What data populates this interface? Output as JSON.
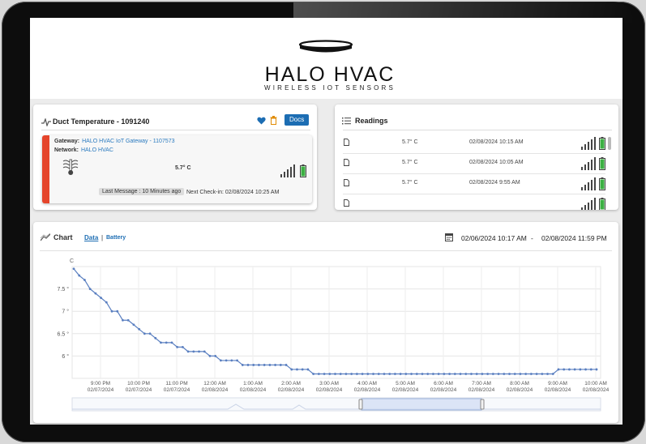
{
  "header": {
    "brand": "HALO HVAC",
    "tagline": "WIRELESS IOT SENSORS"
  },
  "sensor": {
    "title": "Duct Temperature - 1091240",
    "docs_label": "Docs",
    "gateway_label": "Gateway:",
    "gateway_value": "HALO HVAC IoT Gateway - 1107573",
    "network_label": "Network:",
    "network_value": "HALO HVAC",
    "temperature": "5.7° C",
    "last_message": "Last Message : 10 Minutes ago",
    "next_checkin": "Next Check-in: 02/08/2024   10:25 AM",
    "accent_color": "#e5452b"
  },
  "readings": {
    "title": "Readings",
    "rows": [
      {
        "value": "5.7° C",
        "time": "02/08/2024 10:15 AM"
      },
      {
        "value": "5.7° C",
        "time": "02/08/2024 10:05 AM"
      },
      {
        "value": "5.7° C",
        "time": "02/08/2024 9:55 AM"
      }
    ]
  },
  "chart": {
    "title": "Chart",
    "tab_data": "Data",
    "tab_separator": "|",
    "tab_battery": "Battery",
    "date_start": "02/06/2024 10:17 AM",
    "date_separator": "-",
    "date_end": "02/08/2024 11:59 PM"
  },
  "colors": {
    "brand_blue": "#1c6db3",
    "line": "#5a7fc0",
    "battery_green": "#3cb043"
  },
  "chart_data": {
    "type": "line",
    "ylabel": "C",
    "ylim": [
      5.5,
      8.0
    ],
    "yticks": [
      {
        "label": "7.5 °",
        "v": 7.5
      },
      {
        "label": "7 °",
        "v": 7.0
      },
      {
        "label": "6.5 °",
        "v": 6.5
      },
      {
        "label": "6 °",
        "v": 6.0
      }
    ],
    "xticks": [
      {
        "t": "9:00 PM",
        "d": "02/07/2024"
      },
      {
        "t": "10:00 PM",
        "d": "02/07/2024"
      },
      {
        "t": "11:00 PM",
        "d": "02/07/2024"
      },
      {
        "t": "12:00 AM",
        "d": "02/08/2024"
      },
      {
        "t": "1:00 AM",
        "d": "02/08/2024"
      },
      {
        "t": "2:00 AM",
        "d": "02/08/2024"
      },
      {
        "t": "3:00 AM",
        "d": "02/08/2024"
      },
      {
        "t": "4:00 AM",
        "d": "02/08/2024"
      },
      {
        "t": "5:00 AM",
        "d": "02/08/2024"
      },
      {
        "t": "6:00 AM",
        "d": "02/08/2024"
      },
      {
        "t": "7:00 AM",
        "d": "02/08/2024"
      },
      {
        "t": "8:00 AM",
        "d": "02/08/2024"
      },
      {
        "t": "9:00 AM",
        "d": "02/08/2024"
      },
      {
        "t": "10:00 AM",
        "d": "02/08/2024"
      }
    ],
    "series": [
      {
        "values": [
          7.95,
          7.8,
          7.7,
          7.5,
          7.4,
          7.3,
          7.2,
          7.0,
          7.0,
          6.8,
          6.8,
          6.7,
          6.6,
          6.5,
          6.5,
          6.4,
          6.3,
          6.3,
          6.3,
          6.2,
          6.2,
          6.1,
          6.1,
          6.1,
          6.1,
          6.0,
          6.0,
          5.9,
          5.9,
          5.9,
          5.9,
          5.8,
          5.8,
          5.8,
          5.8,
          5.8,
          5.8,
          5.8,
          5.8,
          5.8,
          5.7,
          5.7,
          5.7,
          5.7,
          5.6,
          5.6,
          5.6,
          5.6,
          5.6,
          5.6,
          5.6,
          5.6,
          5.6,
          5.6,
          5.6,
          5.6,
          5.6,
          5.6,
          5.6,
          5.6,
          5.6,
          5.6,
          5.6,
          5.6,
          5.6,
          5.6,
          5.6,
          5.6,
          5.6,
          5.6,
          5.6,
          5.6,
          5.6,
          5.6,
          5.6,
          5.6,
          5.6,
          5.6,
          5.6,
          5.6,
          5.6,
          5.6,
          5.6,
          5.6,
          5.6,
          5.6,
          5.6,
          5.6,
          5.6,
          5.7,
          5.7,
          5.7,
          5.7,
          5.7,
          5.7,
          5.7,
          5.7
        ]
      }
    ]
  }
}
